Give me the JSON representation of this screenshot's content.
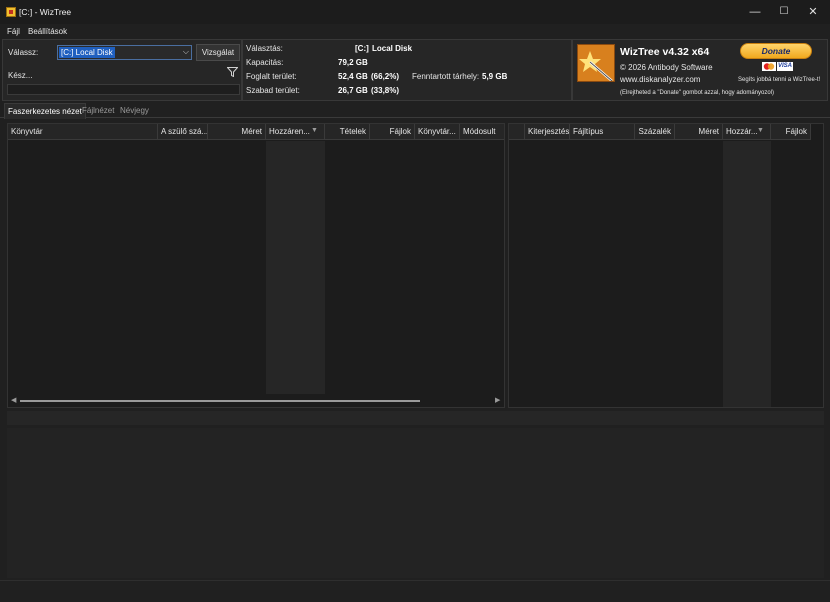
{
  "window": {
    "title": "[C:]  - WizTree",
    "min": "—",
    "max": "☐",
    "close": "✕"
  },
  "menu": {
    "file": "Fájl",
    "settings": "Beállítások"
  },
  "scan": {
    "select_label": "Válassz:",
    "drive_value": "[C:] Local Disk",
    "scan_button": "Vizsgálat",
    "status": "Kész..."
  },
  "info": {
    "selected_label": "Választás:",
    "selected_drive": "[C:]",
    "selected_name": "Local Disk",
    "capacity_label": "Kapacitás:",
    "capacity": "79,2 GB",
    "used_label": "Foglalt terület:",
    "used": "52,4 GB",
    "used_pct": "(66,2%)",
    "reserved_label": "Fenntartott tárhely:",
    "reserved": "5,9 GB",
    "free_label": "Szabad terület:",
    "free": "26,7 GB",
    "free_pct": "(33,8%)"
  },
  "about": {
    "product": "WizTree v4.32 x64",
    "copyright": "© 2026 Antibody Software",
    "website": "www.diskanalyzer.com",
    "donate_button": "Donate",
    "donate_help": "Segíts jobbá tenni a WizTree-t!",
    "donate_note": "(Elrejtheted a \"Donate\" gombot azzal, hogy adományozol)",
    "visa": "VISA"
  },
  "tabs": {
    "tree": "Faszerkezetes nézet",
    "files": "Fájlnézet",
    "about": "Névjegy"
  },
  "tree_columns": {
    "folder": "Könyvtár",
    "parent": "A szülő szá...",
    "size": "Méret",
    "allocated": "Hozzáren...",
    "items": "Tételek",
    "files": "Fájlok",
    "folders": "Könyvtár...",
    "modified": "Módosult"
  },
  "ext_columns": {
    "ext": "Kiterjesztés",
    "type": "Fájltípus",
    "percent": "Százalék",
    "size": "Méret",
    "allocated": "Hozzár...",
    "files": "Fájlok"
  },
  "colors": {
    "accent": "#1f5fbf",
    "background": "#202020",
    "donate": "#f0a81e"
  }
}
